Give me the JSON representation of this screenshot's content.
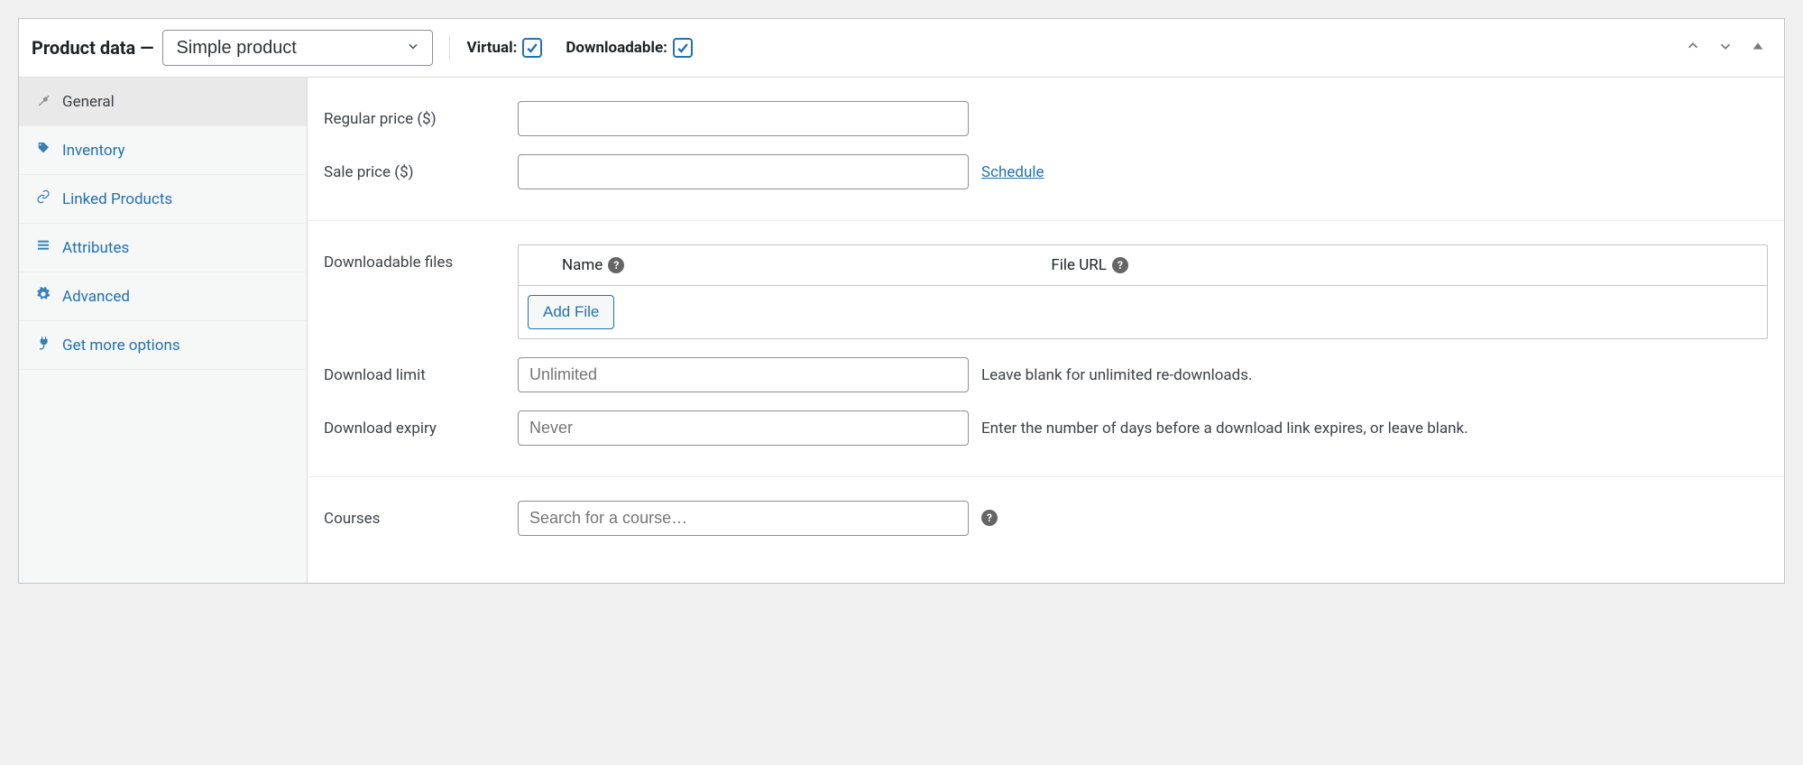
{
  "header": {
    "title": "Product data —",
    "product_type": "Simple product",
    "virtual_label": "Virtual:",
    "virtual_checked": true,
    "downloadable_label": "Downloadable:",
    "downloadable_checked": true
  },
  "tabs": [
    {
      "id": "general",
      "label": "General",
      "active": true
    },
    {
      "id": "inventory",
      "label": "Inventory",
      "active": false
    },
    {
      "id": "linked",
      "label": "Linked Products",
      "active": false
    },
    {
      "id": "attributes",
      "label": "Attributes",
      "active": false
    },
    {
      "id": "advanced",
      "label": "Advanced",
      "active": false
    },
    {
      "id": "getmore",
      "label": "Get more options",
      "active": false
    }
  ],
  "fields": {
    "regular_price": {
      "label": "Regular price ($)",
      "value": ""
    },
    "sale_price": {
      "label": "Sale price ($)",
      "value": "",
      "schedule_text": "Schedule"
    },
    "downloadable_files": {
      "label": "Downloadable files",
      "col_name": "Name",
      "col_url": "File URL",
      "add_file_btn": "Add File"
    },
    "download_limit": {
      "label": "Download limit",
      "placeholder": "Unlimited",
      "help": "Leave blank for unlimited re-downloads."
    },
    "download_expiry": {
      "label": "Download expiry",
      "placeholder": "Never",
      "help": "Enter the number of days before a download link expires, or leave blank."
    },
    "courses": {
      "label": "Courses",
      "placeholder": "Search for a course…"
    }
  }
}
